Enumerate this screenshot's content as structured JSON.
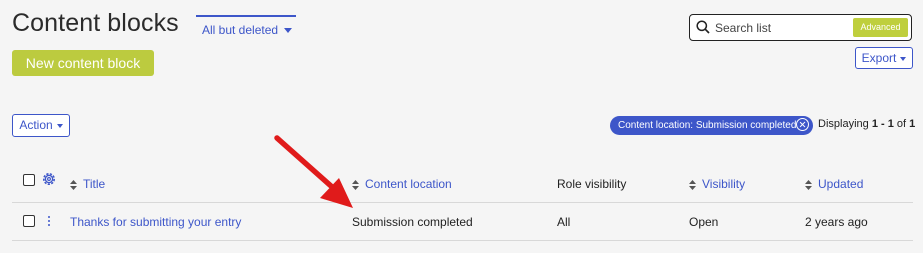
{
  "header": {
    "title": "Content blocks",
    "filter_label": "All but deleted",
    "search": {
      "placeholder": "Search list",
      "advanced_label": "Advanced"
    },
    "new_button_label": "New content block",
    "export_label": "Export"
  },
  "toolbar": {
    "action_label": "Action",
    "active_filter": "Content location: Submission completed",
    "displaying": {
      "prefix": "Displaying",
      "range": "1 - 1",
      "of_label": "of",
      "total": "1"
    }
  },
  "table": {
    "columns": [
      {
        "key": "title",
        "label": "Title",
        "sortable": true
      },
      {
        "key": "content_location",
        "label": "Content location",
        "sortable": true
      },
      {
        "key": "role_visibility",
        "label": "Role visibility",
        "sortable": false
      },
      {
        "key": "visibility",
        "label": "Visibility",
        "sortable": true
      },
      {
        "key": "updated",
        "label": "Updated",
        "sortable": true
      }
    ],
    "rows": [
      {
        "title": "Thanks for submitting your entry",
        "content_location": "Submission completed",
        "role_visibility": "All",
        "visibility": "Open",
        "updated": "2 years ago"
      }
    ]
  },
  "colors": {
    "accent": "#3d56c9",
    "brand_green": "#bccb3f",
    "annotation_red": "#e01b1b"
  },
  "icons": [
    "search-icon",
    "gear-icon",
    "sort-icon",
    "kebab-menu-icon",
    "close-circle-icon",
    "caret-down-icon",
    "arrow-annotation"
  ]
}
